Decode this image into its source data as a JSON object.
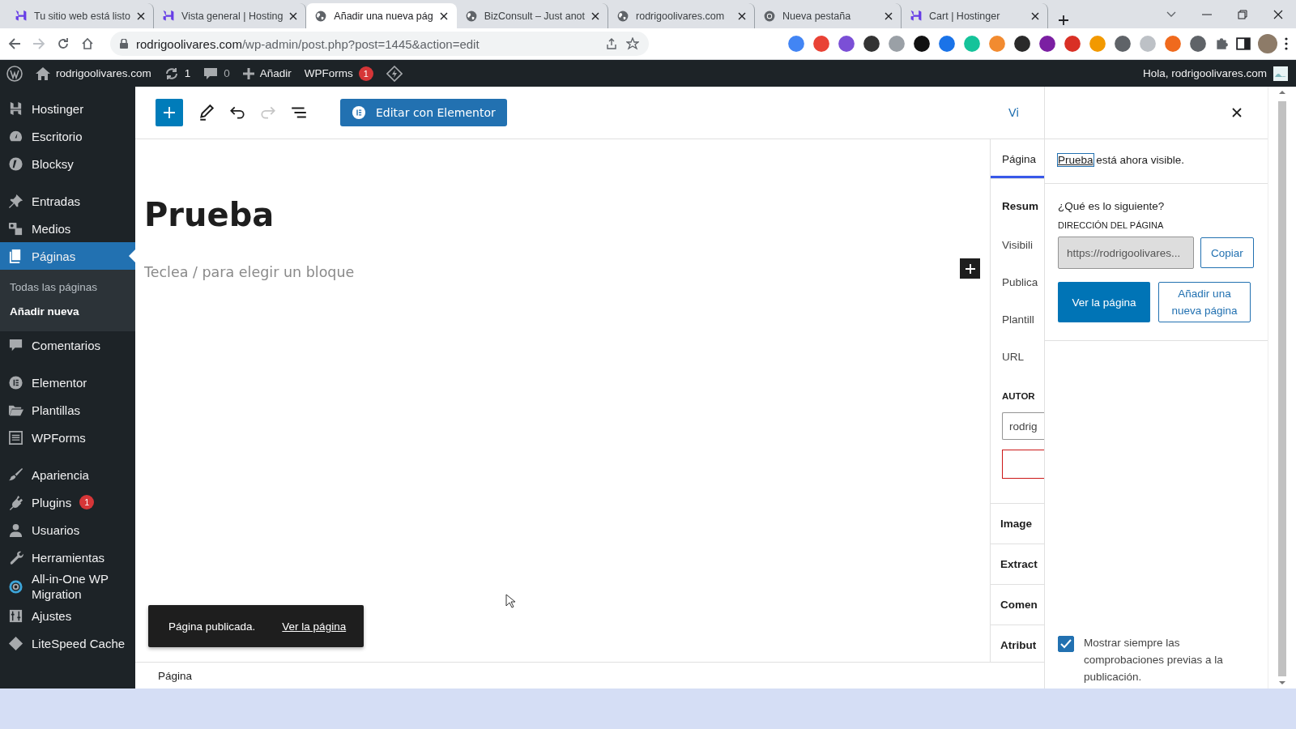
{
  "browser": {
    "tabs": [
      {
        "title": "Tu sitio web está listo",
        "kind": "hostinger",
        "selected": false
      },
      {
        "title": "Vista general | Hosting",
        "kind": "hostinger",
        "selected": false
      },
      {
        "title": "Añadir una nueva pág",
        "kind": "globe",
        "selected": true
      },
      {
        "title": "BizConsult – Just anot",
        "kind": "globe",
        "selected": false
      },
      {
        "title": "rodrigoolivares.com",
        "kind": "globe",
        "selected": false
      },
      {
        "title": "Nueva pestaña",
        "kind": "chrome",
        "selected": false
      },
      {
        "title": "Cart | Hostinger",
        "kind": "hostinger",
        "selected": false
      }
    ],
    "address_host": "rodrigoolivares.com",
    "address_path": "/wp-admin/post.php?post=1445&action=edit"
  },
  "admin_bar": {
    "site": "rodrigoolivares.com",
    "updates": "1",
    "comments": "0",
    "new": "Añadir",
    "wpforms": "WPForms",
    "wpforms_badge": "1",
    "greeting": "Hola, rodrigoolivares.com"
  },
  "sidebar": {
    "groups": [
      {
        "items": [
          {
            "label": "Hostinger",
            "kind": "hostinger",
            "selected": false
          },
          {
            "label": "Escritorio",
            "kind": "dashboard",
            "selected": false
          },
          {
            "label": "Blocksy",
            "kind": "blocksy",
            "selected": false
          }
        ]
      },
      {
        "items": [
          {
            "label": "Entradas",
            "kind": "pin",
            "selected": false
          },
          {
            "label": "Medios",
            "kind": "media",
            "selected": false
          },
          {
            "label": "Páginas",
            "kind": "pages",
            "selected": true,
            "children": [
              {
                "label": "Todas las páginas",
                "selected": false
              },
              {
                "label": "Añadir nueva",
                "selected": true
              }
            ]
          },
          {
            "label": "Comentarios",
            "kind": "comment",
            "selected": false
          }
        ]
      },
      {
        "items": [
          {
            "label": "Elementor",
            "kind": "elementor",
            "selected": false
          },
          {
            "label": "Plantillas",
            "kind": "folder",
            "selected": false
          },
          {
            "label": "WPForms",
            "kind": "form",
            "selected": false
          }
        ]
      },
      {
        "items": [
          {
            "label": "Apariencia",
            "kind": "brush",
            "selected": false
          },
          {
            "label": "Plugins",
            "kind": "plug",
            "selected": false,
            "badge": "1"
          },
          {
            "label": "Usuarios",
            "kind": "user",
            "selected": false
          },
          {
            "label": "Herramientas",
            "kind": "wrench",
            "selected": false
          },
          {
            "label": "All-in-One WP Migration",
            "kind": "migration",
            "selected": false
          },
          {
            "label": "Ajustes",
            "kind": "settings",
            "selected": false
          },
          {
            "label": "LiteSpeed Cache",
            "kind": "litespeed",
            "selected": false
          }
        ]
      }
    ]
  },
  "editor": {
    "tools": [
      {
        "kind": "inserter",
        "disabled": false
      },
      {
        "kind": "edit",
        "disabled": false
      },
      {
        "kind": "undo",
        "disabled": false
      },
      {
        "kind": "redo",
        "disabled": true
      },
      {
        "kind": "list-view",
        "disabled": false
      }
    ],
    "elementor_button": "Editar con Elementor",
    "view_link": "Vi",
    "title": "Prueba",
    "placeholder": "Teclea / para elegir un bloque",
    "snackbar": {
      "message": "Página publicada.",
      "link": "Ver la página"
    },
    "breadcrumb": "Página"
  },
  "settings_sidebar": {
    "tab": {
      "label": "Página",
      "selected": true
    },
    "rows": [
      {
        "kind": "heading",
        "label": "Resum"
      },
      {
        "kind": "row",
        "label": "Visibili"
      },
      {
        "kind": "row",
        "label": "Publica"
      },
      {
        "kind": "row",
        "label": "Plantill"
      },
      {
        "kind": "row",
        "label": "URL"
      },
      {
        "kind": "caps",
        "label": "AUTOR"
      },
      {
        "kind": "field",
        "label": "rodrig"
      },
      {
        "kind": "error-field"
      },
      {
        "kind": "panel",
        "label": "Image"
      },
      {
        "kind": "panel",
        "label": "Extract"
      },
      {
        "kind": "panel",
        "label": "Comen"
      },
      {
        "kind": "panel",
        "label": "Atribut"
      }
    ]
  },
  "publish_panel": {
    "link": "Prueba",
    "message": "está ahora visible.",
    "next_heading": "¿Qué es lo siguiente?",
    "address_label": "DIRECCIÓN DEL PÁGINA",
    "address_value": "https://rodrigoolivares...",
    "copy": "Copiar",
    "view": "Ver la página",
    "add_new": "Añadir una nueva página",
    "always_show_checks": {
      "label": "Mostrar siempre las comprobaciones previas a la publicación.",
      "checked": true
    }
  }
}
